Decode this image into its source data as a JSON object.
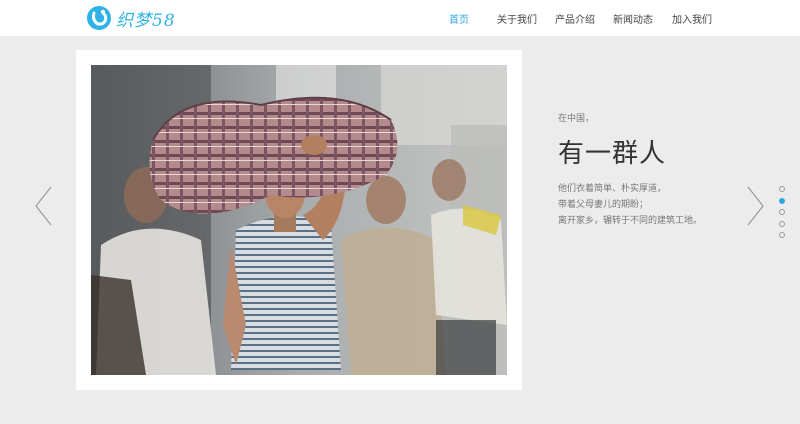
{
  "header": {
    "logo_text": "织梦58",
    "nav": [
      {
        "label": "首页",
        "active": true
      },
      {
        "label": "关于我们",
        "active": false
      },
      {
        "label": "产品介绍",
        "active": false
      },
      {
        "label": "新闻动态",
        "active": false
      },
      {
        "label": "加入我们",
        "active": false
      }
    ]
  },
  "slide": {
    "kicker": "在中国，",
    "headline": "有一群人",
    "lines": [
      "他们衣着简单、朴实厚道，",
      "带着父母妻儿的期盼；",
      "离开家乡，辗转于不同的建筑工地。"
    ],
    "current_index": 2,
    "total": 5
  },
  "icons": {
    "prev": "chevron-left-icon",
    "next": "chevron-right-icon"
  },
  "colors": {
    "accent": "#2fa7e0",
    "logo": "#2fb3e6",
    "background": "#ececec"
  }
}
